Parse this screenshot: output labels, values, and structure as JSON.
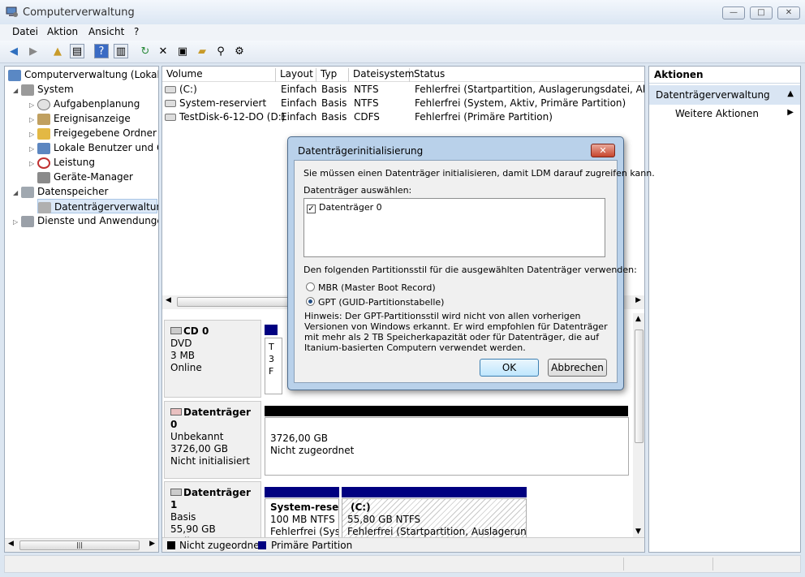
{
  "window": {
    "title": "Computerverwaltung",
    "min": "—",
    "max": "□",
    "close": "✕"
  },
  "menu": [
    "Datei",
    "Aktion",
    "Ansicht",
    "?"
  ],
  "tree": {
    "root": "Computerverwaltung (Lokal)",
    "system": "System",
    "items": [
      "Aufgabenplanung",
      "Ereignisanzeige",
      "Freigegebene Ordner",
      "Lokale Benutzer und Gru",
      "Leistung",
      "Geräte-Manager"
    ],
    "storage": "Datenspeicher",
    "diskmgmt": "Datenträgerverwaltung",
    "services": "Dienste und Anwendungen"
  },
  "volumes": {
    "headers": [
      "Volume",
      "Layout",
      "Typ",
      "Dateisystem",
      "Status"
    ],
    "rows": [
      [
        "(C:)",
        "Einfach",
        "Basis",
        "NTFS",
        "Fehlerfrei (Startpartition, Auslagerungsdatei, Absturzabbild, Primäre Partition)"
      ],
      [
        "System-reserviert",
        "Einfach",
        "Basis",
        "NTFS",
        "Fehlerfrei (System, Aktiv, Primäre Partition)"
      ],
      [
        "TestDisk-6-12-DO (D:)",
        "Einfach",
        "Basis",
        "CDFS",
        "Fehlerfrei (Primäre Partition)"
      ]
    ]
  },
  "disks": {
    "cd0": {
      "name": "CD 0",
      "type": "DVD",
      "size": "3 MB",
      "state": "Online",
      "cell": [
        "T",
        "3",
        "F"
      ]
    },
    "disk0": {
      "name": "Datenträger 0",
      "type": "Unbekannt",
      "size": "3726,00 GB",
      "state": "Nicht initialisiert",
      "cell_size": "3726,00 GB",
      "cell_state": "Nicht zugeordnet"
    },
    "disk1": {
      "name": "Datenträger 1",
      "type": "Basis",
      "size": "55,90 GB",
      "state": "Online",
      "p1": {
        "name": "System-reserv",
        "size": "100 MB NTFS",
        "status": "Fehlerfrei (Syste"
      },
      "p2": {
        "name": "(C:)",
        "size": "55,80 GB NTFS",
        "status": "Fehlerfrei (Startpartition, Auslagerungsda"
      }
    }
  },
  "legend": {
    "unallocated": "Nicht zugeordnet",
    "primary": "Primäre Partition",
    "unallocated_color": "#000000",
    "primary_color": "#000080"
  },
  "actions": {
    "header": "Aktionen",
    "section": "Datenträgerverwaltung",
    "more": "Weitere Aktionen"
  },
  "dialog": {
    "title": "Datenträgerinitialisierung",
    "intro": "Sie müssen einen Datenträger initialisieren, damit LDM darauf zugreifen kann.",
    "select_label": "Datenträger auswählen:",
    "disk_item": "Datenträger 0",
    "style_label": "Den folgenden Partitionsstil für die ausgewählten Datenträger verwenden:",
    "mbr": "MBR (Master Boot Record)",
    "gpt": "GPT (GUID-Partitionstabelle)",
    "hint": "Hinweis: Der GPT-Partitionsstil wird nicht von allen vorherigen Versionen von Windows erkannt. Er wird empfohlen für Datenträger mit mehr als 2 TB Speicherkapazität oder für Datenträger, die auf Itanium-basierten Computern verwendet werden.",
    "ok": "OK",
    "cancel": "Abbrechen"
  }
}
